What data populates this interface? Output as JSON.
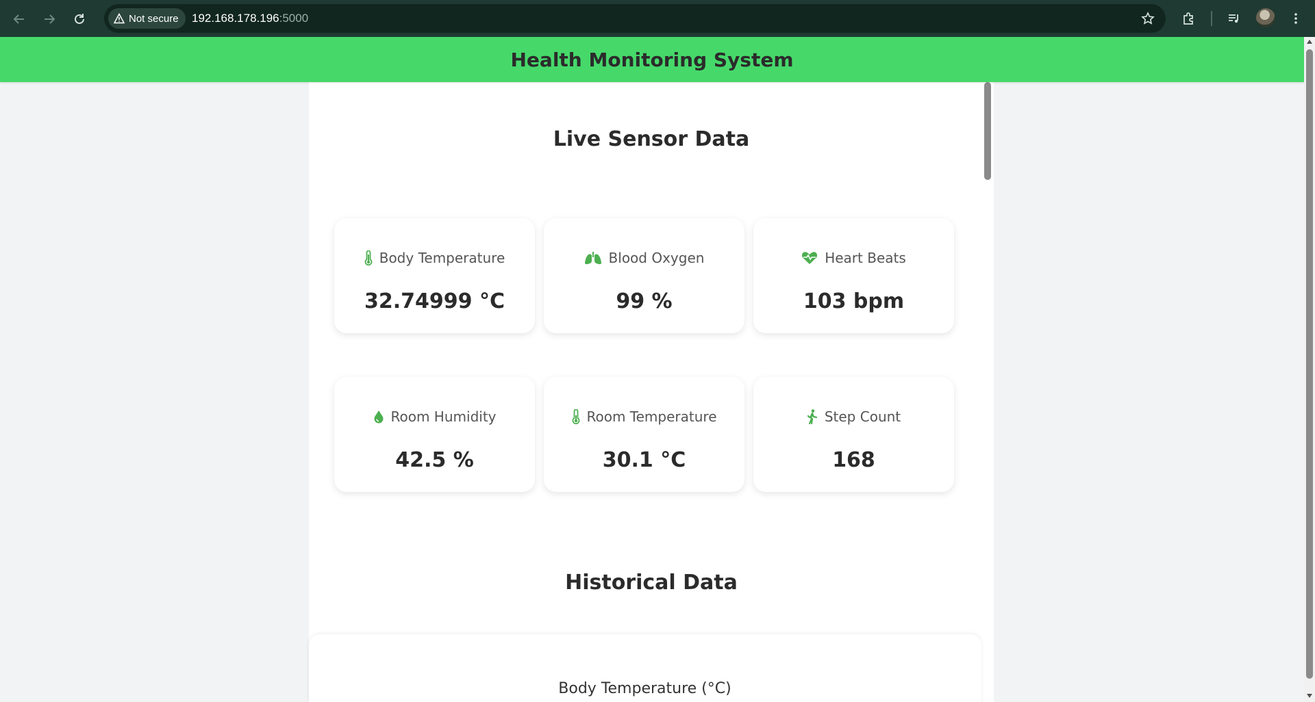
{
  "browser": {
    "security_label": "Not secure",
    "url_host": "192.168.178.196",
    "url_port": ":5000"
  },
  "app": {
    "title": "Health Monitoring System",
    "accent_color": "#46d96a",
    "icon_color": "#4caf50"
  },
  "live": {
    "title": "Live Sensor Data",
    "cards": [
      {
        "icon": "thermometer-icon",
        "label": "Body Temperature",
        "value": "32.74999 °C"
      },
      {
        "icon": "lungs-icon",
        "label": "Blood Oxygen",
        "value": "99 %"
      },
      {
        "icon": "heartbeat-icon",
        "label": "Heart Beats",
        "value": "103 bpm"
      },
      {
        "icon": "droplet-icon",
        "label": "Room Humidity",
        "value": "42.5 %"
      },
      {
        "icon": "thermometer-icon",
        "label": "Room Temperature",
        "value": "30.1 °C"
      },
      {
        "icon": "walking-icon",
        "label": "Step Count",
        "value": "168"
      }
    ]
  },
  "historical": {
    "title": "Historical Data",
    "chart_title": "Body Temperature (°C)"
  }
}
